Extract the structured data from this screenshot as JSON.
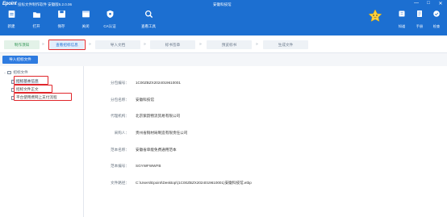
{
  "titlebar": {
    "brand": "Epoint",
    "app_title": "投标文件制作软件 安徽版5.2.0.06",
    "doc_title": "安徽科技馆",
    "window_controls": [
      "—",
      "□",
      "✕"
    ]
  },
  "toolbar": {
    "left": [
      {
        "label": "新建",
        "icon": "new-file-icon"
      },
      {
        "label": "打开",
        "icon": "folder-open-icon"
      },
      {
        "label": "保存",
        "icon": "save-icon"
      },
      {
        "label": "关闭",
        "icon": "close-doc-icon"
      },
      {
        "label": "CA认证",
        "icon": "shield-icon"
      },
      {
        "label": "查看工具",
        "icon": "search-icon"
      }
    ],
    "right": [
      {
        "label": "知道",
        "icon": "book-icon"
      },
      {
        "label": "手册",
        "icon": "manual-icon"
      },
      {
        "label": "检查",
        "icon": "check-icon"
      }
    ]
  },
  "steps": [
    {
      "label": "制作须知",
      "state": "done"
    },
    {
      "label": "查看招标信息",
      "state": "active"
    },
    {
      "label": "导入文档",
      "state": "pending"
    },
    {
      "label": "标书签章",
      "state": "pending"
    },
    {
      "label": "预览标书",
      "state": "pending"
    },
    {
      "label": "生成文件",
      "state": "pending"
    }
  ],
  "import_button": "导入招标文件",
  "tree": {
    "root": "招标文件",
    "items": [
      {
        "label": "招标基本信息"
      },
      {
        "label": "招标文件正文"
      },
      {
        "label": "平台使用费网上支付流程"
      }
    ]
  },
  "detail": [
    {
      "key": "分包编号：",
      "value": "1C00ZBZX2024019610001"
    },
    {
      "key": "分包名称：",
      "value": "安徽科技馆"
    },
    {
      "key": "代理机构：",
      "value": "北京紫韵物流贸易有限公司"
    },
    {
      "key": "采购人：",
      "value": "贵州省铜材局制造有限责任公司"
    },
    {
      "key": "范本名称：",
      "value": "安徽省单能免费通用范本"
    },
    {
      "key": "范本编号：",
      "value": "SGYWFWWFB"
    },
    {
      "key": "文件路径：",
      "value": "C:\\Users\\Epoint\\Desktop\\(1C00ZBZX2024019610001)安徽科技馆.etbp"
    }
  ],
  "colors": {
    "primary": "#1c6fd1",
    "highlight": "#e0262b",
    "step_done": "#3a9a5c"
  }
}
